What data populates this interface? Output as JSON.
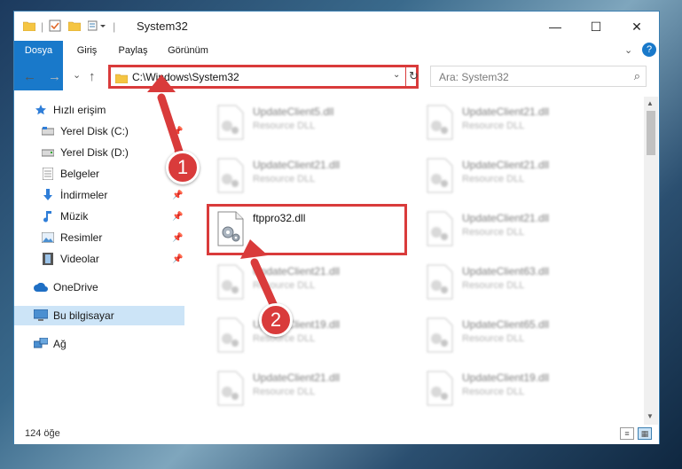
{
  "window": {
    "title": "System32",
    "controls": {
      "minimize": "—",
      "maximize": "☐",
      "close": "✕"
    }
  },
  "ribbon": {
    "tabs": [
      "Dosya",
      "Giriş",
      "Paylaş",
      "Görünüm"
    ],
    "expand_icon": "chevron-down-icon",
    "help_icon": "?"
  },
  "navigation": {
    "back": "←",
    "forward": "→",
    "recent": "⌄",
    "up": "↑",
    "address": "C:\\Windows\\System32",
    "search_placeholder": "Ara: System32"
  },
  "sidebar": {
    "items": [
      {
        "label": "Hızlı erişim",
        "icon": "star-icon",
        "pinned": false
      },
      {
        "label": "Yerel Disk (C:)",
        "icon": "drive-icon",
        "pinned": true
      },
      {
        "label": "Yerel Disk (D:)",
        "icon": "drive-icon",
        "pinned": true
      },
      {
        "label": "Belgeler",
        "icon": "documents-icon",
        "pinned": true
      },
      {
        "label": "İndirmeler",
        "icon": "download-icon",
        "pinned": true
      },
      {
        "label": "Müzik",
        "icon": "music-icon",
        "pinned": true
      },
      {
        "label": "Resimler",
        "icon": "pictures-icon",
        "pinned": true
      },
      {
        "label": "Videolar",
        "icon": "videos-icon",
        "pinned": true
      },
      {
        "label": "OneDrive",
        "icon": "cloud-icon",
        "pinned": false
      },
      {
        "label": "Bu bilgisayar",
        "icon": "computer-icon",
        "pinned": false,
        "selected": true
      },
      {
        "label": "Ağ",
        "icon": "network-icon",
        "pinned": false
      }
    ]
  },
  "files": {
    "column_left": [
      {
        "name": "UpdateClient5.dll",
        "type": "Resource DLL"
      },
      {
        "name": "UpdateClient21.dll",
        "type": "Resource DLL"
      },
      {
        "name": "ftppro32.dll",
        "type": "",
        "highlighted": true
      },
      {
        "name": "UpdateClient21.dll",
        "type": "Resource DLL"
      },
      {
        "name": "UpdateClient19.dll",
        "type": "Resource DLL"
      },
      {
        "name": "UpdateClient21.dll",
        "type": "Resource DLL"
      }
    ],
    "column_right": [
      {
        "name": "UpdateClient21.dll",
        "type": "Resource DLL"
      },
      {
        "name": "UpdateClient21.dll",
        "type": "Resource DLL"
      },
      {
        "name": "UpdateClient21.dll",
        "type": "Resource DLL"
      },
      {
        "name": "UpdateClient63.dll",
        "type": "Resource DLL"
      },
      {
        "name": "UpdateClient65.dll",
        "type": "Resource DLL"
      },
      {
        "name": "UpdateClient19.dll",
        "type": "Resource DLL"
      }
    ]
  },
  "status": {
    "item_count": "124 öğe"
  },
  "annotations": {
    "step1": "1",
    "step2": "2",
    "color": "#d93b3b"
  }
}
